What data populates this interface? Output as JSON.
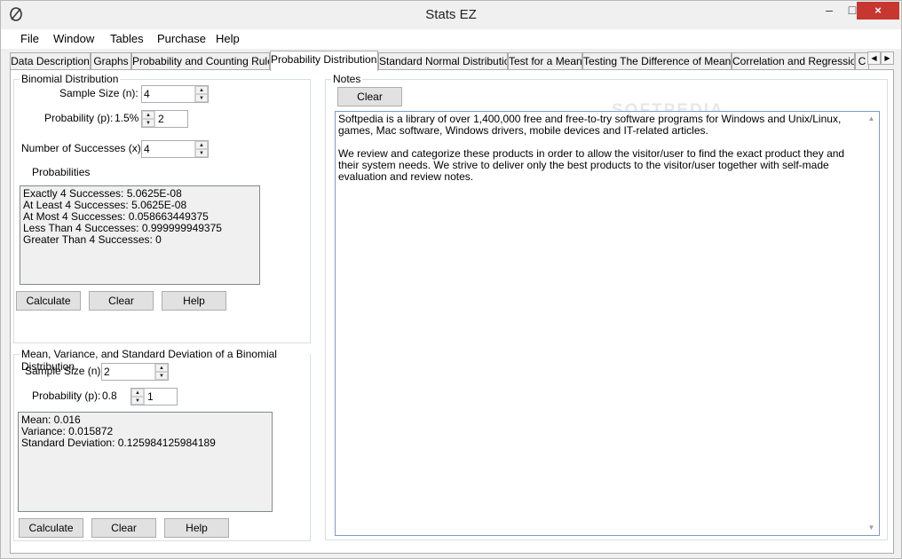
{
  "window": {
    "title": "Stats EZ",
    "close_glyph": "×",
    "minimize_glyph": "–",
    "maximize_glyph": "□"
  },
  "menu": [
    "File",
    "Window",
    "Tables",
    "Purchase",
    "Help"
  ],
  "tabs": [
    "Data Description",
    "Graphs",
    "Probability and Counting Rules",
    "Probability Distributions",
    "Standard Normal Distribution",
    "Test for a Mean",
    "Testing The Difference of Means",
    "Correlation and Regression",
    "C"
  ],
  "active_tab": "Probability Distributions",
  "binomial": {
    "title": "Binomial Distribution",
    "sample_size_label": "Sample Size (n):",
    "sample_size_value": "4",
    "probability_label": "Probability (p):",
    "probability_display": "1.5%",
    "probability_value": "2",
    "successes_label": "Number of Successes (x):",
    "successes_value": "4",
    "probabilities_label": "Probabilities",
    "results": [
      "Exactly 4 Successes: 5.0625E-08",
      "At Least 4 Successes: 5.0625E-08",
      "At Most 4 Successes: 0.058663449375",
      "Less Than 4 Successes: 0.999999949375",
      "Greater Than 4 Successes: 0"
    ],
    "buttons": {
      "calculate": "Calculate",
      "clear": "Clear",
      "help": "Help"
    }
  },
  "mean_var": {
    "title": "Mean, Variance, and Standard Deviation of a Binomial Distribution",
    "sample_size_label": "Sample Size (n):",
    "sample_size_value": "2",
    "probability_label": "Probability (p):",
    "probability_display": "0.8",
    "probability_value": "1",
    "results": [
      "Mean: 0.016",
      "Variance: 0.015872",
      "Standard Deviation: 0.125984125984189"
    ],
    "buttons": {
      "calculate": "Calculate",
      "clear": "Clear",
      "help": "Help"
    }
  },
  "notes": {
    "title": "Notes",
    "clear_button": "Clear",
    "paragraphs": [
      "Softpedia is a library of over 1,400,000 free and free-to-try software programs for Windows and Unix/Linux, games, Mac software, Windows drivers, mobile devices and IT-related articles.",
      "We review and categorize these products in order to allow the visitor/user to find the exact product they and their system needs. We strive to deliver only the best products to the visitor/user together with self-made evaluation and review notes."
    ]
  },
  "watermark": "SOFTPEDIA"
}
